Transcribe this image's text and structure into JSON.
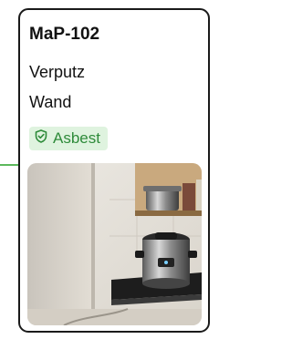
{
  "card": {
    "title": "MaP-102",
    "material": "Verputz",
    "location": "Wand",
    "badge_label": "Asbest"
  },
  "colors": {
    "accent": "#5cb85c",
    "badge_bg": "#dff3df",
    "badge_text": "#2e8b3a",
    "border": "#1a1a1a"
  },
  "icons": {
    "badge_icon": "shield-check-icon"
  }
}
